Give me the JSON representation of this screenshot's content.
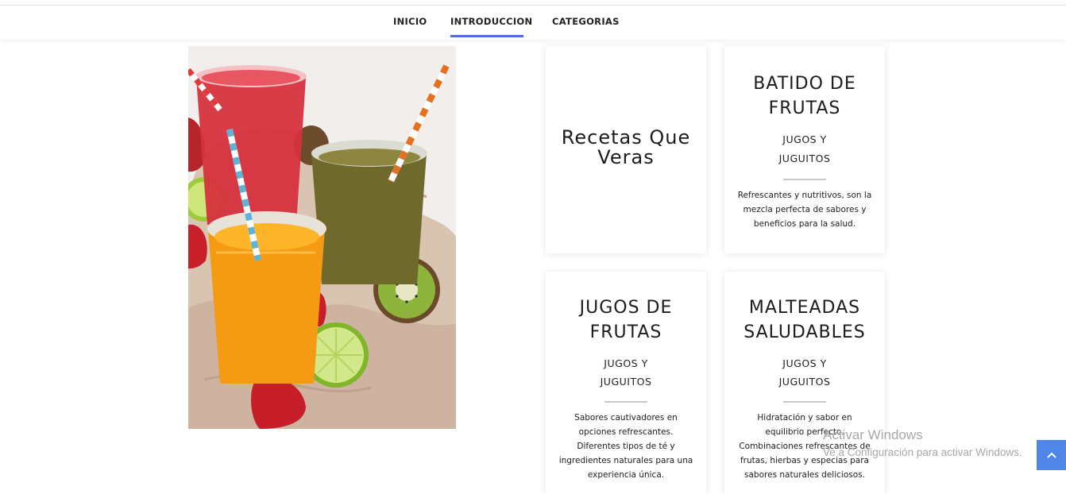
{
  "nav": {
    "items": [
      {
        "label": "INICIO",
        "active": false
      },
      {
        "label": "INTRODUCCION",
        "active": true
      },
      {
        "label": "CATEGORIAS",
        "active": false
      }
    ]
  },
  "hero_image": {
    "icon": "juices-photo"
  },
  "intro_card": {
    "title": "Recetas Que Veras"
  },
  "cards": [
    {
      "title_lines": [
        "BATIDO DE",
        "FRUTAS"
      ],
      "sub_lines": [
        "JUGOS Y",
        "JUGUITOS"
      ],
      "text_lines": [
        "Refrescantes y nutritivos, son la",
        "mezcla perfecta de sabores y",
        "beneficios para la salud."
      ]
    },
    {
      "title_lines": [
        "JUGOS DE",
        "FRUTAS"
      ],
      "sub_lines": [
        "JUGOS Y",
        "JUGUITOS"
      ],
      "text_lines": [
        "Sabores cautivadores en",
        "opciones refrescantes.",
        "Diferentes tipos de té y",
        "ingredientes naturales para una",
        "experiencia única."
      ]
    },
    {
      "title_lines": [
        "MALTEADAS",
        "SALUDABLES"
      ],
      "sub_lines": [
        "JUGOS Y",
        "JUGUITOS"
      ],
      "text_lines": [
        "Hidratación y sabor en",
        "equilibrio perfecto.",
        "Combinaciones refrescantes de",
        "frutas, hierbas y especias para",
        "sabores naturales deliciosos."
      ]
    }
  ],
  "watermark": {
    "line1": "Activar Windows",
    "line2": "Ve a Configuración para activar Windows."
  },
  "scroll_top": {
    "icon": "chevron-up-icon"
  },
  "colors": {
    "accent": "#4f6fe0",
    "scroll_button": "#4f86e8"
  }
}
